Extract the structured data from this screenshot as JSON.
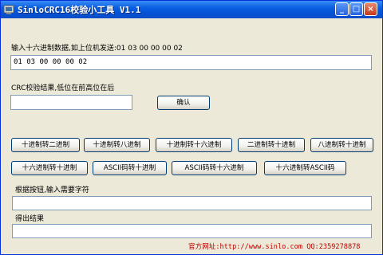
{
  "window": {
    "title": "SinloCRC16校验小工具 V1.1",
    "controls": {
      "minimize": "_",
      "maximize": "□",
      "close": "×"
    }
  },
  "input": {
    "label": "输入十六进制数据,如上位机发送:01 03 00 00 00 02",
    "value": "01 03 00 00 00 02"
  },
  "crc": {
    "label": "CRC校验结果,低位在前高位在后",
    "value": "",
    "confirm_label": "确认"
  },
  "conversions": {
    "row1": [
      "十进制转二进制",
      "十进制转八进制",
      "十进制转十六进制",
      "二进制转十进制",
      "八进制转十进制"
    ],
    "row2": [
      "十六进制转十进制",
      "ASCII码转十进制",
      "ASCII码转十六进制",
      "十六进制转ASCII码"
    ]
  },
  "prompt_field": {
    "label": "根据按钮,输入需要字符",
    "value": ""
  },
  "result_field": {
    "label": "得出结果",
    "value": ""
  },
  "footer": {
    "text": "官方网址:http://www.sinlo.com   QQ:2359278878"
  },
  "colors": {
    "title_bar": "#0553d5",
    "window_bg": "#ece9d8",
    "footer_text": "#c00000",
    "field_border": "#7f9db9"
  },
  "icons": {
    "app": "app-icon",
    "minimize": "minimize-icon",
    "maximize": "maximize-icon",
    "close": "close-icon"
  }
}
